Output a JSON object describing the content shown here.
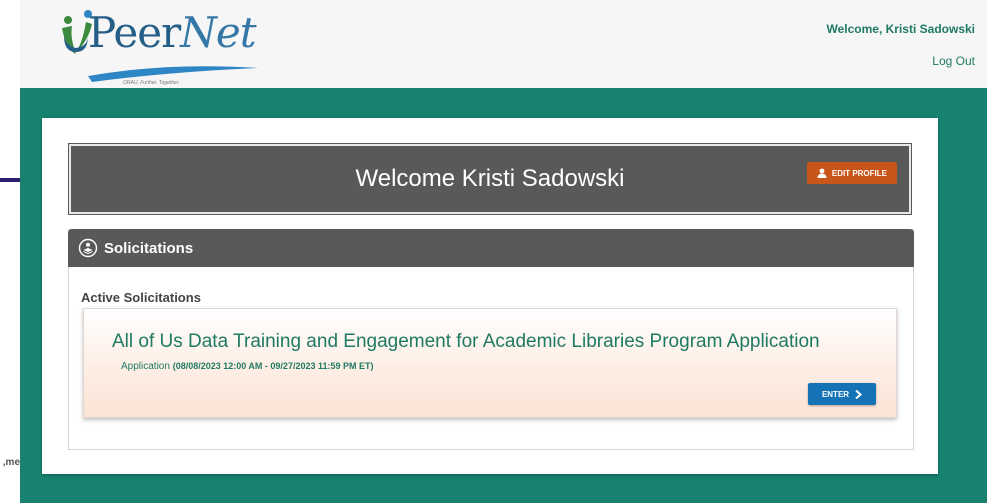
{
  "background": {
    "cut_text": "me,"
  },
  "header": {
    "logo_main": "Peer",
    "logo_accent": "Net",
    "tagline": "ORAU. Further. Together.",
    "welcome_user": "Welcome, Kristi Sadowski",
    "logout_label": "Log Out"
  },
  "banner": {
    "title": "Welcome Kristi Sadowski",
    "edit_profile_label": "EDIT PROFILE"
  },
  "solicitations": {
    "section_title": "Solicitations",
    "active_label": "Active Solicitations",
    "items": [
      {
        "title": "All of Us Data Training and Engagement for Academic Libraries Program Application",
        "type_label": "Application",
        "dates": "(08/08/2023 12:00 AM - 09/27/2023 11:59 PM ET)",
        "enter_label": "ENTER"
      }
    ]
  },
  "colors": {
    "teal_background": "#16826f",
    "banner_gray": "#595959",
    "edit_profile_orange": "#c8561a",
    "enter_blue": "#1573b5",
    "text_green": "#1f7a63",
    "logo_blue": "#255f88"
  },
  "icons": {
    "logo_mark": "people-heart-icon",
    "edit_profile": "person-icon",
    "solicitations": "globe-stack-icon",
    "enter": "chevron-right-icon"
  }
}
